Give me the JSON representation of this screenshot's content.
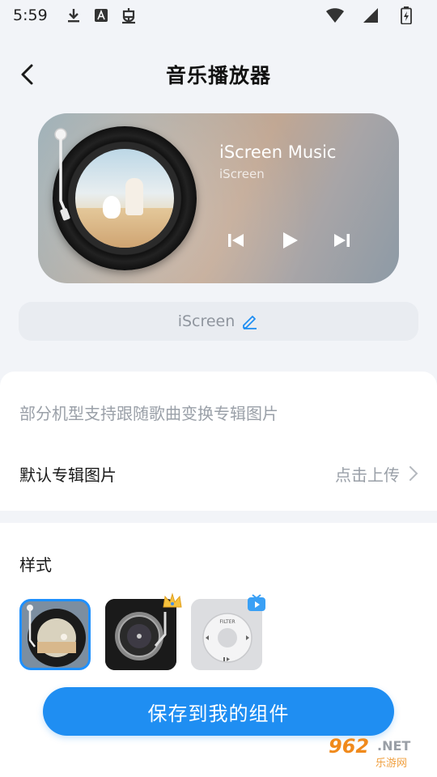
{
  "status_bar": {
    "time": "5:59"
  },
  "header": {
    "title": "音乐播放器"
  },
  "player": {
    "title": "iScreen Music",
    "artist": "iScreen"
  },
  "name_field": {
    "value": "iScreen"
  },
  "album_section": {
    "hint": "部分机型支持跟随歌曲变换专辑图片",
    "default_label": "默认专辑图片",
    "upload_action": "点击上传"
  },
  "style_section": {
    "label": "样式",
    "thumb3_text": "FILTER"
  },
  "save_button": {
    "label": "保存到我的组件"
  },
  "watermark": {
    "number": "962",
    "suffix": ".NET",
    "chinese": "乐游网"
  },
  "colors": {
    "accent": "#1f8ef2",
    "background": "#f2f4f8"
  }
}
